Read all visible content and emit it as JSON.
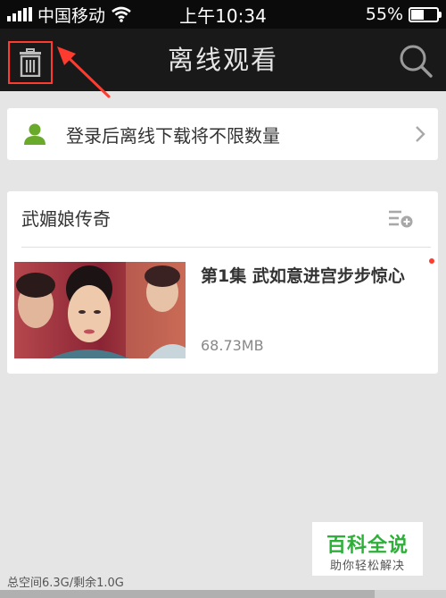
{
  "status_bar": {
    "carrier": "中国移动",
    "time": "上午10:34",
    "battery": "55%",
    "battery_level": 0.55,
    "icons": [
      "signal-bars-icon",
      "wifi-icon",
      "battery-icon"
    ]
  },
  "nav": {
    "title": "离线观看",
    "left_icon": "trash-icon",
    "right_icon": "search-icon",
    "annotation_color": "#ff3b30"
  },
  "login_banner": {
    "text": "登录后离线下载将不限数量",
    "icon": "user-icon",
    "accent": "#6aaa2a"
  },
  "series": {
    "title": "武媚娘传奇",
    "action_icon": "add-to-playlist-icon",
    "episodes": [
      {
        "title": "第1集 武如意进宫步步惊心",
        "size": "68.73MB",
        "is_new": true
      }
    ]
  },
  "watermark": {
    "main": "百科全说",
    "sub": "助你轻松解决",
    "color": "#2eaf3a"
  },
  "storage": {
    "label": "总空间6.3G/剩余1.0G",
    "used_fraction": 0.84
  }
}
